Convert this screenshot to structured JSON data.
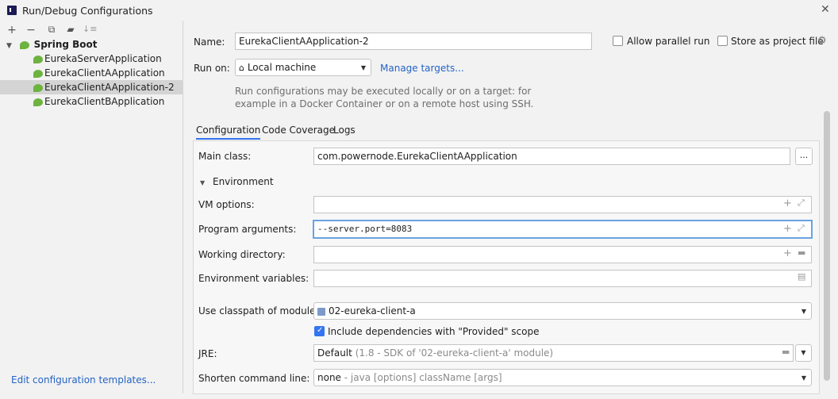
{
  "window": {
    "title": "Run/Debug Configurations"
  },
  "toolbar": {
    "add": "+",
    "remove": "−",
    "copy": "⧉",
    "move": "▰",
    "sort": "↓≡"
  },
  "tree": {
    "group": "Spring Boot",
    "items": [
      {
        "label": "EurekaServerApplication"
      },
      {
        "label": "EurekaClientAApplication"
      },
      {
        "label": "EurekaClientAApplication-2"
      },
      {
        "label": "EurekaClientBApplication"
      }
    ]
  },
  "edit_templates_label": "Edit configuration templates...",
  "form": {
    "name_label": "Name:",
    "name_value": "EurekaClientAApplication-2",
    "allow_parallel_label": "Allow parallel run",
    "store_project_label": "Store as project file",
    "run_on_label": "Run on:",
    "run_on_value": "Local machine",
    "manage_targets": "Manage targets...",
    "hint_line1": "Run configurations may be executed locally or on a target: for",
    "hint_line2": "example in a Docker Container or on a remote host using SSH."
  },
  "tabs": [
    "Configuration",
    "Code Coverage",
    "Logs"
  ],
  "config": {
    "main_class_label": "Main class:",
    "main_class_value": "com.powernode.EurekaClientAApplication",
    "environment_label": "Environment",
    "vm_options_label": "VM options:",
    "vm_options_value": "",
    "program_args_label": "Program arguments:",
    "program_args_value": "--server.port=8083",
    "working_dir_label": "Working directory:",
    "env_vars_label": "Environment variables:",
    "classpath_label": "Use classpath of module:",
    "classpath_value": "02-eureka-client-a",
    "include_deps_label": "Include dependencies with \"Provided\" scope",
    "jre_label": "JRE:",
    "jre_value": "Default",
    "jre_detail": "(1.8 - SDK of '02-eureka-client-a' module)",
    "shorten_label": "Shorten command line:",
    "shorten_value": "none",
    "shorten_detail": "- java [options] className [args]"
  }
}
